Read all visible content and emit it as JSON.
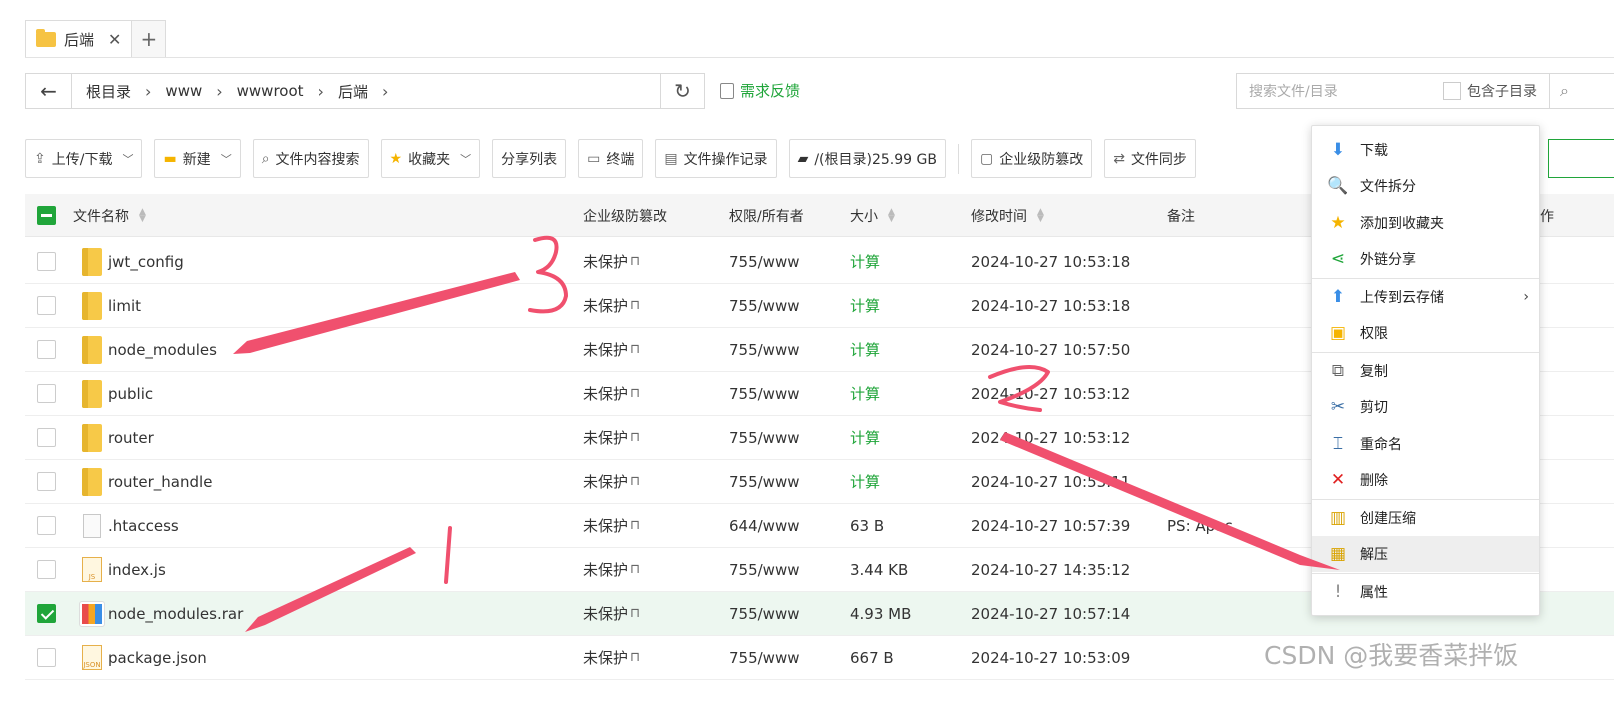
{
  "tabs": [
    {
      "label": "后端",
      "close": "✕"
    }
  ],
  "tab_add": "+",
  "path": {
    "back": "←",
    "crumbs": [
      "根目录",
      "www",
      "wwwroot",
      "后端"
    ],
    "sep": "›",
    "refresh": "↻"
  },
  "feedback": "需求反馈",
  "search": {
    "placeholder": "搜索文件/目录",
    "subdir_label": "包含子目录"
  },
  "toolbar": {
    "upload": "上传/下载",
    "new": "新建",
    "content_search": "文件内容搜索",
    "favorites": "收藏夹",
    "share_list": "分享列表",
    "terminal": "终端",
    "op_log": "文件操作记录",
    "disk": "/(根目录)25.99 GB",
    "tamper": "企业级防篡改",
    "sync": "文件同步"
  },
  "table": {
    "headers": {
      "name": "文件名称",
      "tamper": "企业级防篡改",
      "perm": "权限/所有者",
      "size": "大小",
      "mtime": "修改时间",
      "note": "备注",
      "op": "作"
    },
    "rows": [
      {
        "name": "jwt_config",
        "type": "folder",
        "tamper": "未保护",
        "perm": "755/www",
        "size": "计算",
        "mtime": "2024-10-27 10:53:18",
        "note": "",
        "checked": false
      },
      {
        "name": "limit",
        "type": "folder",
        "tamper": "未保护",
        "perm": "755/www",
        "size": "计算",
        "mtime": "2024-10-27 10:53:18",
        "note": "",
        "checked": false
      },
      {
        "name": "node_modules",
        "type": "folder",
        "tamper": "未保护",
        "perm": "755/www",
        "size": "计算",
        "mtime": "2024-10-27 10:57:50",
        "note": "",
        "checked": false
      },
      {
        "name": "public",
        "type": "folder",
        "tamper": "未保护",
        "perm": "755/www",
        "size": "计算",
        "mtime": "2024-10-27 10:53:12",
        "note": "",
        "checked": false
      },
      {
        "name": "router",
        "type": "folder",
        "tamper": "未保护",
        "perm": "755/www",
        "size": "计算",
        "mtime": "2024-10-27 10:53:12",
        "note": "",
        "checked": false
      },
      {
        "name": "router_handle",
        "type": "folder",
        "tamper": "未保护",
        "perm": "755/www",
        "size": "计算",
        "mtime": "2024-10-27 10:53:11",
        "note": "",
        "checked": false
      },
      {
        "name": ".htaccess",
        "type": "file",
        "tamper": "未保护",
        "perm": "644/www",
        "size": "63 B",
        "mtime": "2024-10-27 10:57:39",
        "note": "PS: Apac",
        "checked": false
      },
      {
        "name": "index.js",
        "type": "js",
        "tamper": "未保护",
        "perm": "755/www",
        "size": "3.44 KB",
        "mtime": "2024-10-27 14:35:12",
        "note": "",
        "checked": false
      },
      {
        "name": "node_modules.rar",
        "type": "rar",
        "tamper": "未保护",
        "perm": "755/www",
        "size": "4.93 MB",
        "mtime": "2024-10-27 10:57:14",
        "note": "",
        "checked": true
      },
      {
        "name": "package.json",
        "type": "json",
        "tamper": "未保护",
        "perm": "755/www",
        "size": "667 B",
        "mtime": "2024-10-27 10:53:09",
        "note": "",
        "checked": false
      }
    ]
  },
  "context_menu": [
    {
      "label": "下载",
      "icon": "download-icon",
      "glyph": "⬇",
      "color": "#3a8ee6"
    },
    {
      "label": "文件拆分",
      "icon": "magnifier-icon",
      "glyph": "🔍",
      "color": "#3a8ee6"
    },
    {
      "label": "添加到收藏夹",
      "icon": "star-icon",
      "glyph": "★",
      "color": "#f5b400"
    },
    {
      "label": "外链分享",
      "icon": "share-icon",
      "glyph": "⋖",
      "color": "#20a53a"
    },
    {
      "label": "上传到云存储",
      "icon": "upload-icon",
      "glyph": "⬆",
      "color": "#3a8ee6",
      "submenu": "›"
    },
    {
      "label": "权限",
      "icon": "permission-icon",
      "glyph": "▣",
      "color": "#f5b400"
    },
    {
      "label": "复制",
      "icon": "copy-icon",
      "glyph": "⧉",
      "color": "#666666"
    },
    {
      "label": "剪切",
      "icon": "scissors-icon",
      "glyph": "✂",
      "color": "#3a6ea5"
    },
    {
      "label": "重命名",
      "icon": "rename-icon",
      "glyph": "⌶",
      "color": "#3a6ea5"
    },
    {
      "label": "删除",
      "icon": "delete-icon",
      "glyph": "✕",
      "color": "#e02020"
    },
    {
      "label": "创建压缩",
      "icon": "compress-icon",
      "glyph": "▥",
      "color": "#d9a300"
    },
    {
      "label": "解压",
      "icon": "extract-icon",
      "glyph": "▦",
      "color": "#d9a300"
    },
    {
      "label": "属性",
      "icon": "info-icon",
      "glyph": "!",
      "color": "#888888"
    }
  ],
  "watermark": "CSDN @我要香菜拌饭",
  "colors": {
    "accent": "#20a53a",
    "annotation": "#f0506e"
  }
}
